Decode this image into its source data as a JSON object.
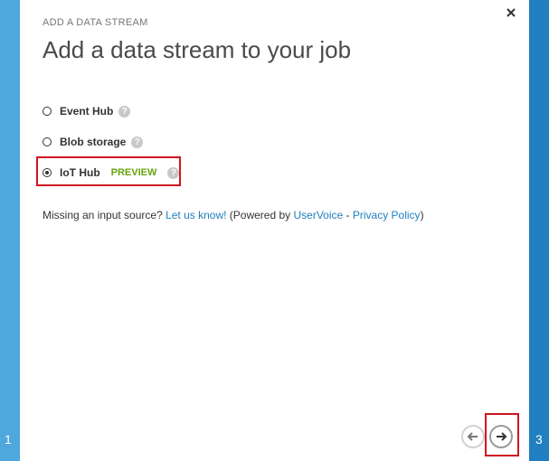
{
  "wizard": {
    "current_step": "1",
    "next_step": "3",
    "section_label": "ADD A DATA STREAM",
    "title": "Add a data stream to your job",
    "options": [
      {
        "label": "Event Hub",
        "selected": false
      },
      {
        "label": "Blob storage",
        "selected": false
      },
      {
        "label": "IoT Hub",
        "badge": "PREVIEW",
        "selected": true
      }
    ],
    "help_glyph": "?",
    "missing": {
      "prefix": "Missing an input source? ",
      "link1": "Let us know!",
      "middle": " (Powered by ",
      "link2": "UserVoice",
      "sep": " - ",
      "link3": "Privacy Policy",
      "suffix": ")"
    }
  },
  "icons": {
    "close": "close-icon",
    "back": "arrow-left-icon",
    "next": "arrow-right-icon",
    "help": "question-icon"
  },
  "colors": {
    "accent_left": "#4ea8de",
    "accent_right": "#1f7fc0",
    "link": "#1f7fc0",
    "preview": "#6aa40f",
    "highlight": "#d0141f"
  }
}
